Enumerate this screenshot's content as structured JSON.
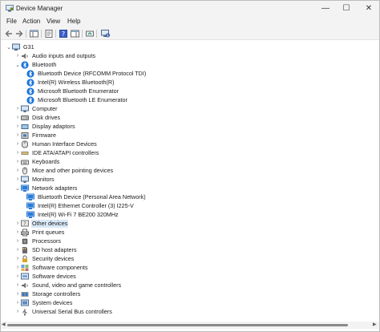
{
  "window": {
    "title": "Device Manager",
    "buttons": {
      "minimize": "—",
      "maximize": "☐",
      "close": "✕"
    }
  },
  "menu": [
    "File",
    "Action",
    "View",
    "Help"
  ],
  "toolbar": {
    "icons": [
      "back-arrow-icon",
      "forward-arrow-icon",
      "show-hide-console-tree-icon",
      "properties-icon",
      "help-icon",
      "action-pane-icon",
      "update-driver-icon",
      "scan-hardware-icon"
    ]
  },
  "tree": {
    "root": "G31",
    "rows": [
      {
        "label": "G31",
        "depth": 0,
        "expander": "expanded",
        "icon": "computer-icon"
      },
      {
        "label": "Audio inputs and outputs",
        "depth": 1,
        "expander": "collapsed",
        "icon": "speaker-icon"
      },
      {
        "label": "Bluetooth",
        "depth": 1,
        "expander": "expanded",
        "icon": "bluetooth-icon"
      },
      {
        "label": "Bluetooth Device (RFCOMM Protocol TDI)",
        "depth": 2,
        "expander": "none",
        "icon": "bluetooth-icon"
      },
      {
        "label": "Intel(R) Wireless Bluetooth(R)",
        "depth": 2,
        "expander": "none",
        "icon": "bluetooth-icon"
      },
      {
        "label": "Microsoft Bluetooth Enumerator",
        "depth": 2,
        "expander": "none",
        "icon": "bluetooth-icon"
      },
      {
        "label": "Microsoft Bluetooth LE Enumerator",
        "depth": 2,
        "expander": "none",
        "icon": "bluetooth-icon"
      },
      {
        "label": "Computer",
        "depth": 1,
        "expander": "collapsed",
        "icon": "monitor-icon"
      },
      {
        "label": "Disk drives",
        "depth": 1,
        "expander": "collapsed",
        "icon": "disk-drive-icon"
      },
      {
        "label": "Display adaptors",
        "depth": 1,
        "expander": "collapsed",
        "icon": "display-adapter-icon"
      },
      {
        "label": "Firmware",
        "depth": 1,
        "expander": "collapsed",
        "icon": "firmware-icon"
      },
      {
        "label": "Human Interface Devices",
        "depth": 1,
        "expander": "collapsed",
        "icon": "hid-icon"
      },
      {
        "label": "IDE ATA/ATAPI controllers",
        "depth": 1,
        "expander": "collapsed",
        "icon": "ide-controller-icon"
      },
      {
        "label": "Keyboards",
        "depth": 1,
        "expander": "collapsed",
        "icon": "keyboard-icon"
      },
      {
        "label": "Mice and other pointing devices",
        "depth": 1,
        "expander": "collapsed",
        "icon": "mouse-icon"
      },
      {
        "label": "Monitors",
        "depth": 1,
        "expander": "collapsed",
        "icon": "monitor-icon"
      },
      {
        "label": "Network adapters",
        "depth": 1,
        "expander": "expanded",
        "icon": "network-adapter-icon"
      },
      {
        "label": "Bluetooth Device (Personal Area Network)",
        "depth": 2,
        "expander": "none",
        "icon": "network-adapter-icon"
      },
      {
        "label": "Intel(R) Ethernet Controller (3) I225-V",
        "depth": 2,
        "expander": "none",
        "icon": "network-adapter-icon"
      },
      {
        "label": "Intel(R) Wi-Fi 7 BE200 320MHz",
        "depth": 2,
        "expander": "none",
        "icon": "network-adapter-icon"
      },
      {
        "label": "Other devices",
        "depth": 1,
        "expander": "collapsed",
        "icon": "unknown-device-icon",
        "selected": true
      },
      {
        "label": "Print queues",
        "depth": 1,
        "expander": "collapsed",
        "icon": "printer-icon"
      },
      {
        "label": "Processors",
        "depth": 1,
        "expander": "collapsed",
        "icon": "processor-icon"
      },
      {
        "label": "SD host adapters",
        "depth": 1,
        "expander": "collapsed",
        "icon": "sd-card-icon"
      },
      {
        "label": "Security devices",
        "depth": 1,
        "expander": "collapsed",
        "icon": "security-key-icon"
      },
      {
        "label": "Software components",
        "depth": 1,
        "expander": "collapsed",
        "icon": "software-component-icon"
      },
      {
        "label": "Software devices",
        "depth": 1,
        "expander": "collapsed",
        "icon": "software-device-icon"
      },
      {
        "label": "Sound, video and game controllers",
        "depth": 1,
        "expander": "collapsed",
        "icon": "speaker-icon"
      },
      {
        "label": "Storage controllers",
        "depth": 1,
        "expander": "collapsed",
        "icon": "storage-controller-icon"
      },
      {
        "label": "System devices",
        "depth": 1,
        "expander": "collapsed",
        "icon": "system-device-icon"
      },
      {
        "label": "Universal Serial Bus controllers",
        "depth": 1,
        "expander": "collapsed",
        "icon": "usb-icon"
      }
    ]
  },
  "colors": {
    "chrome": "#f3f3f3",
    "selection": "#d9e8f7",
    "bluetooth": "#1a73d9",
    "network": "#2b7bd6"
  }
}
